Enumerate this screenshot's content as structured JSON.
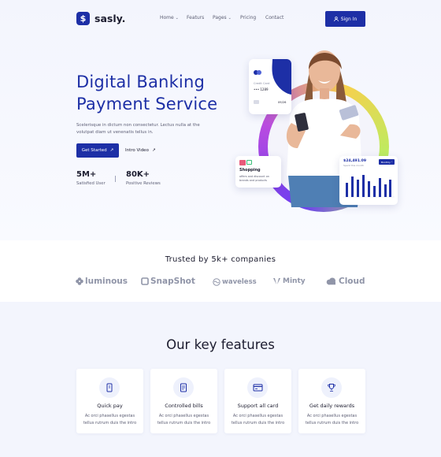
{
  "brand": {
    "name": "sasly.",
    "mark": "$"
  },
  "nav": {
    "items": [
      {
        "label": "Home",
        "has_dropdown": true
      },
      {
        "label": "Featurs",
        "has_dropdown": false
      },
      {
        "label": "Pages",
        "has_dropdown": true
      },
      {
        "label": "Pricing",
        "has_dropdown": false
      },
      {
        "label": "Contact",
        "has_dropdown": false
      }
    ],
    "signin_label": "Sign In",
    "signin_icon": "user-icon"
  },
  "hero": {
    "title_line1": "Digital Banking",
    "title_line2": "Payment Service",
    "lead": "Scelerisque in dictum non consectetur. Lectus nulla at the volutpat diam ut venenatis tellus in.",
    "cta_primary": "Get Started",
    "cta_secondary": "Intro Video",
    "stats": [
      {
        "value": "5M+",
        "label": "Satisfied User"
      },
      {
        "value": "80K+",
        "label": "Positive Reviews"
      }
    ],
    "credit_card": {
      "label": "Credit Card",
      "digits": "1289",
      "expiry": "09/26"
    },
    "shopping_card": {
      "title": "Shopping",
      "text": "offers and discount on brands and products"
    },
    "chart_card": {
      "amount": "$24,491.09",
      "caption": "Spent this month",
      "period": "Monthly"
    },
    "colors": {
      "primary": "#1d2fa6"
    }
  },
  "trusted": {
    "title": "Trusted by 5k+ companies",
    "brands": [
      {
        "name": "luminous",
        "icon": "flower-icon"
      },
      {
        "name": "SnapShot",
        "icon": "square-icon"
      },
      {
        "name": "waveless",
        "icon": "wave-icon"
      },
      {
        "name": "Minty",
        "icon": "leaf-icon"
      },
      {
        "name": "Cloud",
        "icon": "cloud-icon"
      }
    ]
  },
  "features": {
    "title": "Our key features",
    "cards": [
      {
        "title": "Quick pay",
        "text": "Ac orci phasellus egestas tellus rutrum duis the intro",
        "icon": "tap-pay-icon"
      },
      {
        "title": "Controlled bills",
        "text": "Ac orci phasellus egestas tellus rutrum duis the intro",
        "icon": "bill-icon"
      },
      {
        "title": "Support all card",
        "text": "Ac orci phasellus egestas tellus rutrum duis the intro",
        "icon": "card-icon"
      },
      {
        "title": "Get daily rewards",
        "text": "Ac orci phasellus egestas tellus rutrum duis the intro",
        "icon": "trophy-icon"
      }
    ]
  }
}
